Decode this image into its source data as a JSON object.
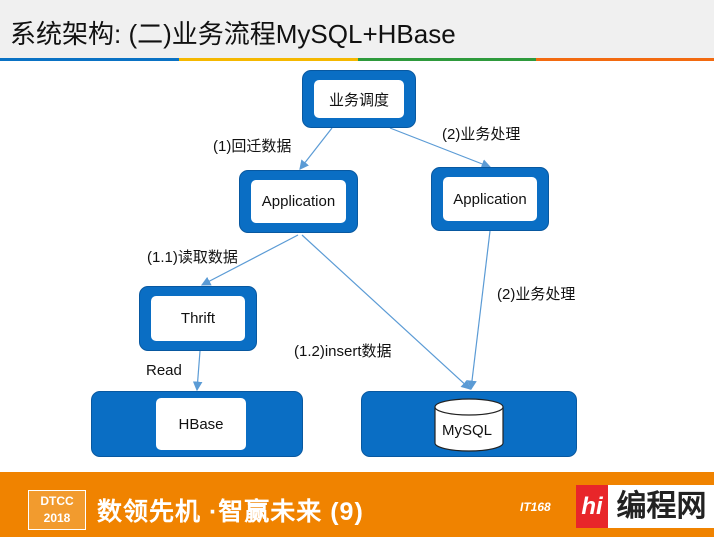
{
  "header": {
    "title": "系统架构: (二)业务流程MySQL+HBase",
    "strip_colors": [
      "#0a72c4",
      "#f5b800",
      "#2e9a3c",
      "#f26a10"
    ]
  },
  "nodes": {
    "scheduler": "业务调度",
    "app_left": "Application",
    "app_right": "Application",
    "thrift": "Thrift",
    "hbase": "HBase",
    "mysql": "MySQL"
  },
  "edges": {
    "e1": "(1)回迁数据",
    "e2": "(2)业务处理",
    "e11": "(1.1)读取数据",
    "e2b": "(2)业务处理",
    "e12": "(1.2)insert数据",
    "read": "Read"
  },
  "footer": {
    "dtcc_line1": "DTCC",
    "dtcc_line2": "2018",
    "slogan": "数领先机 ·智赢未来 (9)",
    "brand_small": "IT168",
    "brand_logo": "编程网",
    "brand_hi": "hi",
    "bg": "#f08300"
  },
  "colors": {
    "box": "#0a6ec4",
    "line": "#5b9bd5"
  }
}
